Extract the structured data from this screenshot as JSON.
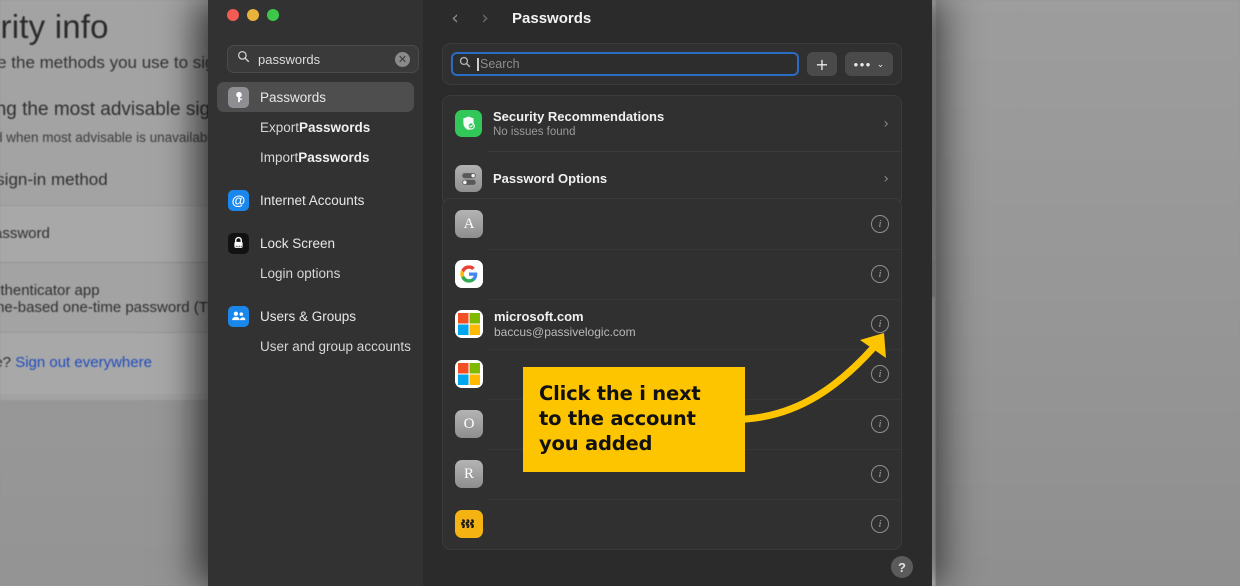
{
  "background_page": {
    "title": "urity info",
    "line_methods": "are the methods you use to sign in",
    "line_advisable": "sing the most advisable sign-in",
    "line_fallback": "hod when most advisable is unavailable: Authe",
    "line_signin_method": "d sign-in method",
    "row_password": "Password",
    "row_auth_app": "Authenticator app",
    "row_auth_sub": "Time-based one-time password (TOTP)",
    "signout_prefix": "vice? ",
    "signout_link": "Sign out everywhere"
  },
  "window": {
    "traffic_lights": [
      "close-button",
      "minimize-button",
      "zoom-button"
    ],
    "sidebar": {
      "search": {
        "value": "passwords",
        "icon": "search-icon",
        "clear_icon": "clear-icon"
      },
      "items": [
        {
          "label": "Passwords",
          "icon": "key-icon",
          "selected": true,
          "type": "item"
        },
        {
          "label_plain": "Export ",
          "label_bold": "Passwords",
          "type": "sub"
        },
        {
          "label_plain": "Import ",
          "label_bold": "Passwords",
          "type": "sub"
        },
        {
          "label": "Internet Accounts",
          "icon": "at-icon",
          "selected": false,
          "type": "item"
        },
        {
          "label": "Lock Screen",
          "icon": "lock-icon",
          "selected": false,
          "type": "item"
        },
        {
          "label_plain": "Login options",
          "label_bold": "",
          "type": "sub"
        },
        {
          "label": "Users & Groups",
          "icon": "users-icon",
          "selected": false,
          "type": "item"
        },
        {
          "label_plain": "User and group accounts",
          "label_bold": "",
          "type": "sub"
        }
      ]
    },
    "detail": {
      "back_icon": "chevron-left-icon",
      "forward_icon": "chevron-right-icon",
      "title": "Passwords",
      "toolbar": {
        "search_placeholder": "Search",
        "search_value": "",
        "add_label": "+",
        "more_dots": "•••",
        "more_chevron": "⌄"
      },
      "options_card": [
        {
          "title": "Security Recommendations",
          "subtitle": "No issues found",
          "icon": "shield-check-icon",
          "chevron": "›"
        },
        {
          "title": "Password Options",
          "subtitle": "",
          "icon": "toggles-icon",
          "chevron": "›"
        }
      ],
      "password_rows": [
        {
          "icon": "letter-a-icon",
          "glyph": "A",
          "style": "letter",
          "title": "",
          "subtitle": "",
          "info": "i"
        },
        {
          "icon": "google-icon",
          "glyph": "G",
          "style": "google",
          "title": "",
          "subtitle": "",
          "info": "i"
        },
        {
          "icon": "microsoft-icon",
          "glyph": "",
          "style": "microsoft",
          "title": "microsoft.com",
          "subtitle": "baccus@passivelogic.com",
          "info": "i"
        },
        {
          "icon": "microsoft-icon",
          "glyph": "",
          "style": "microsoft",
          "title": "",
          "subtitle": "",
          "info": "i"
        },
        {
          "icon": "letter-o-icon",
          "glyph": "O",
          "style": "letter",
          "title": "",
          "subtitle": "",
          "info": "i"
        },
        {
          "icon": "letter-r-icon",
          "glyph": "R",
          "style": "letter",
          "title": "",
          "subtitle": "",
          "info": "i"
        },
        {
          "icon": "wavy-lines-icon",
          "glyph": "}}}",
          "style": "amber",
          "title": "",
          "subtitle": "",
          "info": "i"
        }
      ],
      "help_label": "?"
    }
  },
  "annotation": {
    "callout_text": "Click the i next to the account you added",
    "callout_color": "#fdc500",
    "arrow_color": "#fdc500",
    "arrow_target": "info-button-microsoft-row"
  }
}
